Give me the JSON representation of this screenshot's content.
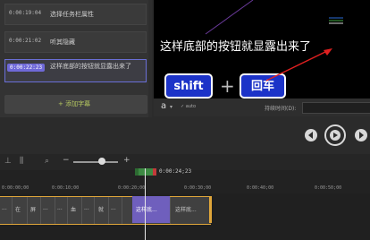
{
  "subtitles": [
    {
      "time": "0:00:19:04",
      "text": "选择任务栏属性"
    },
    {
      "time": "0:00:21:02",
      "text": "听其隐藏"
    },
    {
      "time": "0:00:22:23",
      "text": "这样底部的按钮就显露出来了"
    }
  ],
  "add_subtitle": "+ 添加字幕",
  "preview": {
    "caption": "这样底部的按钮就显露出来了",
    "key1": "shift",
    "plus": "+",
    "key2": "回车"
  },
  "controls": {
    "aa": "a",
    "aa_check": "✓ auto",
    "duration_label": "持续时间(D):"
  },
  "timeline": {
    "playhead_time": "0:00:24;23",
    "ticks": [
      "0:00:00;00",
      "0:00:10;00",
      "0:00:20;00",
      "0:00:30;00",
      "0:00:40;00",
      "0:00:50;00"
    ],
    "segments": [
      "...",
      "在",
      "屏",
      "...",
      "...",
      "血",
      "...",
      "就",
      "...",
      "这样底...",
      "这样底..."
    ]
  }
}
